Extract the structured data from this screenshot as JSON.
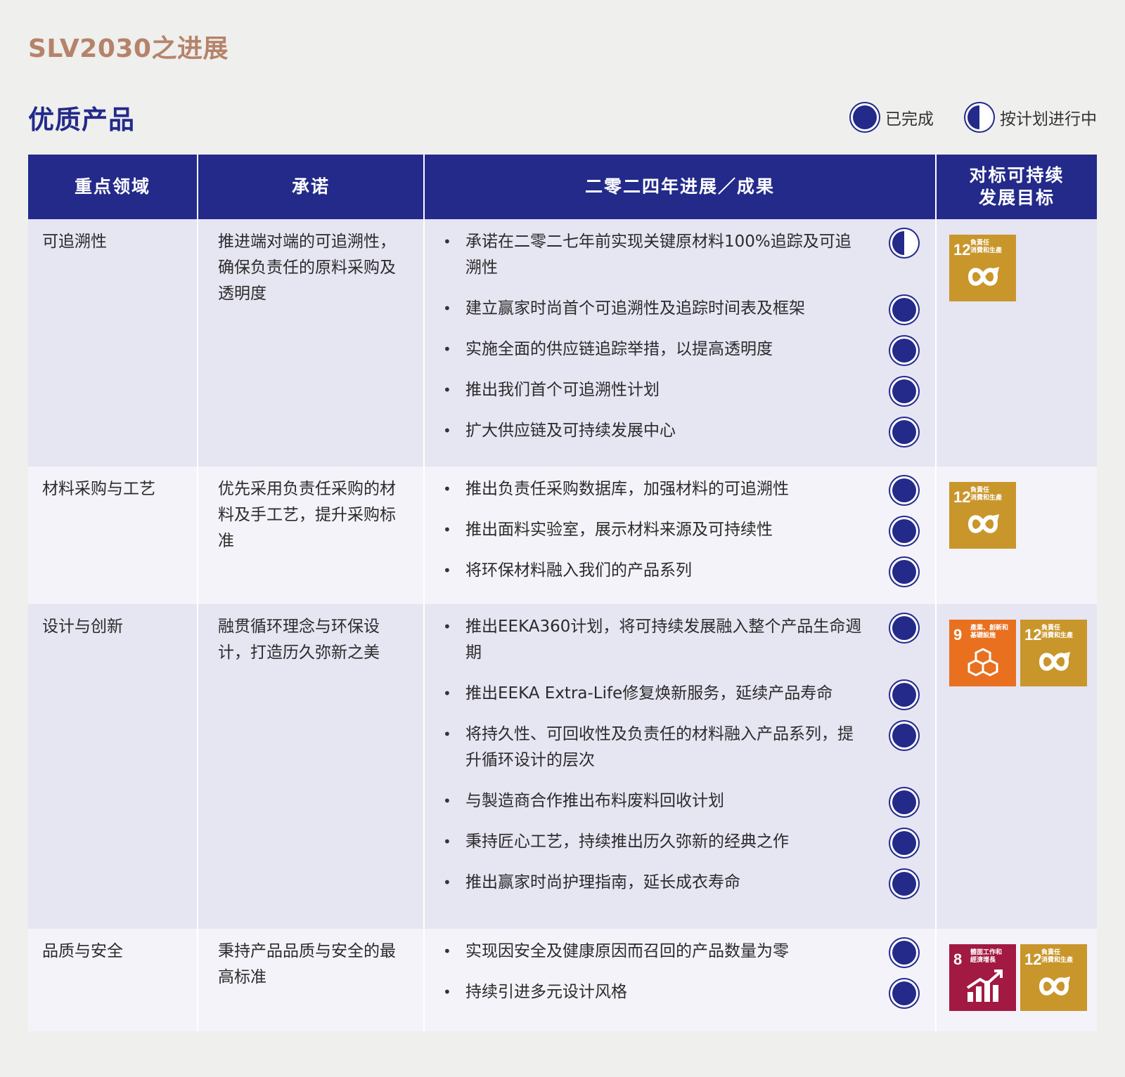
{
  "header": {
    "eyebrow": "SLV2030之进展",
    "section_title": "优质产品"
  },
  "legend": {
    "completed": "已完成",
    "in_progress": "按计划进行中"
  },
  "table": {
    "columns": [
      "重点领域",
      "承诺",
      "二零二四年进展／成果",
      "对标可持续\n发展目标"
    ],
    "rows": [
      {
        "area": "可追溯性",
        "commitment": "推进端对端的可追溯性，确保负责任的原料采购及透明度",
        "items": [
          {
            "text": "承诺在二零二七年前实现关键原材料100%追踪及可追溯性",
            "status": "in_progress"
          },
          {
            "text": "建立赢家时尚首个可追溯性及追踪时间表及框架",
            "status": "completed"
          },
          {
            "text": "实施全面的供应链追踪举措，以提高透明度",
            "status": "completed"
          },
          {
            "text": "推出我们首个可追溯性计划",
            "status": "completed"
          },
          {
            "text": "扩大供应链及可持续发展中心",
            "status": "completed"
          }
        ],
        "sdgs": [
          {
            "num": "12",
            "label": "負責任\n消費和生產",
            "icon": "infinity-icon",
            "color": "#c9962b"
          }
        ]
      },
      {
        "area": "材料采购与工艺",
        "commitment": "优先采用负责任采购的材料及手工艺，提升采购标准",
        "items": [
          {
            "text": "推出负责任采购数据库，加强材料的可追溯性",
            "status": "completed"
          },
          {
            "text": "推出面料实验室，展示材料来源及可持续性",
            "status": "completed"
          },
          {
            "text": "将环保材料融入我们的产品系列",
            "status": "completed"
          }
        ],
        "sdgs": [
          {
            "num": "12",
            "label": "負責任\n消費和生產",
            "icon": "infinity-icon",
            "color": "#c9962b"
          }
        ]
      },
      {
        "area": "设计与创新",
        "commitment": "融贯循环理念与环保设计，打造历久弥新之美",
        "items": [
          {
            "text": "推出EEKA360计划，将可持续发展融入整个产品生命週期",
            "status": "completed"
          },
          {
            "text": "推出EEKA Extra-Life修复焕新服务，延续产品寿命",
            "status": "completed"
          },
          {
            "text": "将持久性、可回收性及负责任的材料融入产品系列，提升循环设计的层次",
            "status": "completed"
          },
          {
            "text": "与製造商合作推出布料废料回收计划",
            "status": "completed"
          },
          {
            "text": "秉持匠心工艺，持续推出历久弥新的经典之作",
            "status": "completed"
          },
          {
            "text": "推出赢家时尚护理指南，延长成衣寿命",
            "status": "completed"
          }
        ],
        "sdgs": [
          {
            "num": "9",
            "label": "產業、創新和\n基礎設施",
            "icon": "cubes-icon",
            "color": "#e8701f"
          },
          {
            "num": "12",
            "label": "負責任\n消費和生產",
            "icon": "infinity-icon",
            "color": "#c9962b"
          }
        ]
      },
      {
        "area": "品质与安全",
        "commitment": "秉持产品品质与安全的最高标准",
        "items": [
          {
            "text": "实现因安全及健康原因而召回的产品数量为零",
            "status": "completed"
          },
          {
            "text": "持续引进多元设计风格",
            "status": "completed"
          }
        ],
        "sdgs": [
          {
            "num": "8",
            "label": "體面工作和\n經濟增長",
            "icon": "growth-chart-icon",
            "color": "#a21942"
          },
          {
            "num": "12",
            "label": "負責任\n消費和生產",
            "icon": "infinity-icon",
            "color": "#c9962b"
          }
        ]
      }
    ]
  }
}
